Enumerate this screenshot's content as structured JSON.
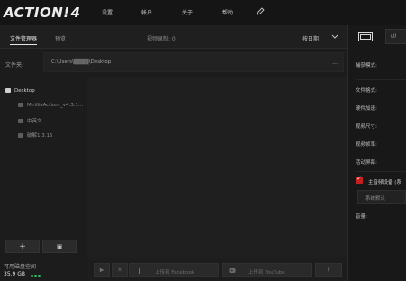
{
  "app": {
    "logo_text": "ACTION!",
    "logo_version": "4"
  },
  "menu": [
    {
      "label": "设置"
    },
    {
      "label": "帐户"
    },
    {
      "label": "关于"
    },
    {
      "label": "帮助"
    }
  ],
  "tabs": [
    {
      "label": "文件管理器",
      "active": true
    },
    {
      "label": "预览",
      "active": false
    }
  ],
  "video_count": "视频录制: 0",
  "sort": {
    "label": "按日期"
  },
  "folder": {
    "label": "文件夹:",
    "path": "C:\\Users\\▒▒▒▒\\Desktop",
    "more": "..."
  },
  "tree": [
    {
      "label": "Desktop",
      "level": 0
    },
    {
      "label": "MirillisAction!_v4.3.1...",
      "level": 1
    },
    {
      "label": "中英文",
      "level": 1
    },
    {
      "label": "破解1.3.15",
      "level": 1
    }
  ],
  "sidebar_buttons": {
    "add": "+",
    "image": "▣"
  },
  "disk": {
    "label": "可用磁盘空间",
    "value": "35.9 GB",
    "dots": 3
  },
  "bottom_buttons": {
    "play": "▶",
    "close": "✕",
    "facebook": "上传到 Facebook",
    "youtube": "上传到 YouTube",
    "upload": "⬆"
  },
  "right_panel": {
    "tab2_label": "UI",
    "fields": [
      "捕获模式:",
      "文件格式:",
      "硬件加速:",
      "视频尺寸:",
      "视频帧率:",
      "活动屏幕:"
    ],
    "audio_checkbox": "主音频设备 (系",
    "audio_device": "系统默认",
    "volume_label": "音量:"
  },
  "colors": {
    "accent": "#c71f1f",
    "disk_ok": "#2ec76b",
    "background": "#1b1b1b"
  }
}
